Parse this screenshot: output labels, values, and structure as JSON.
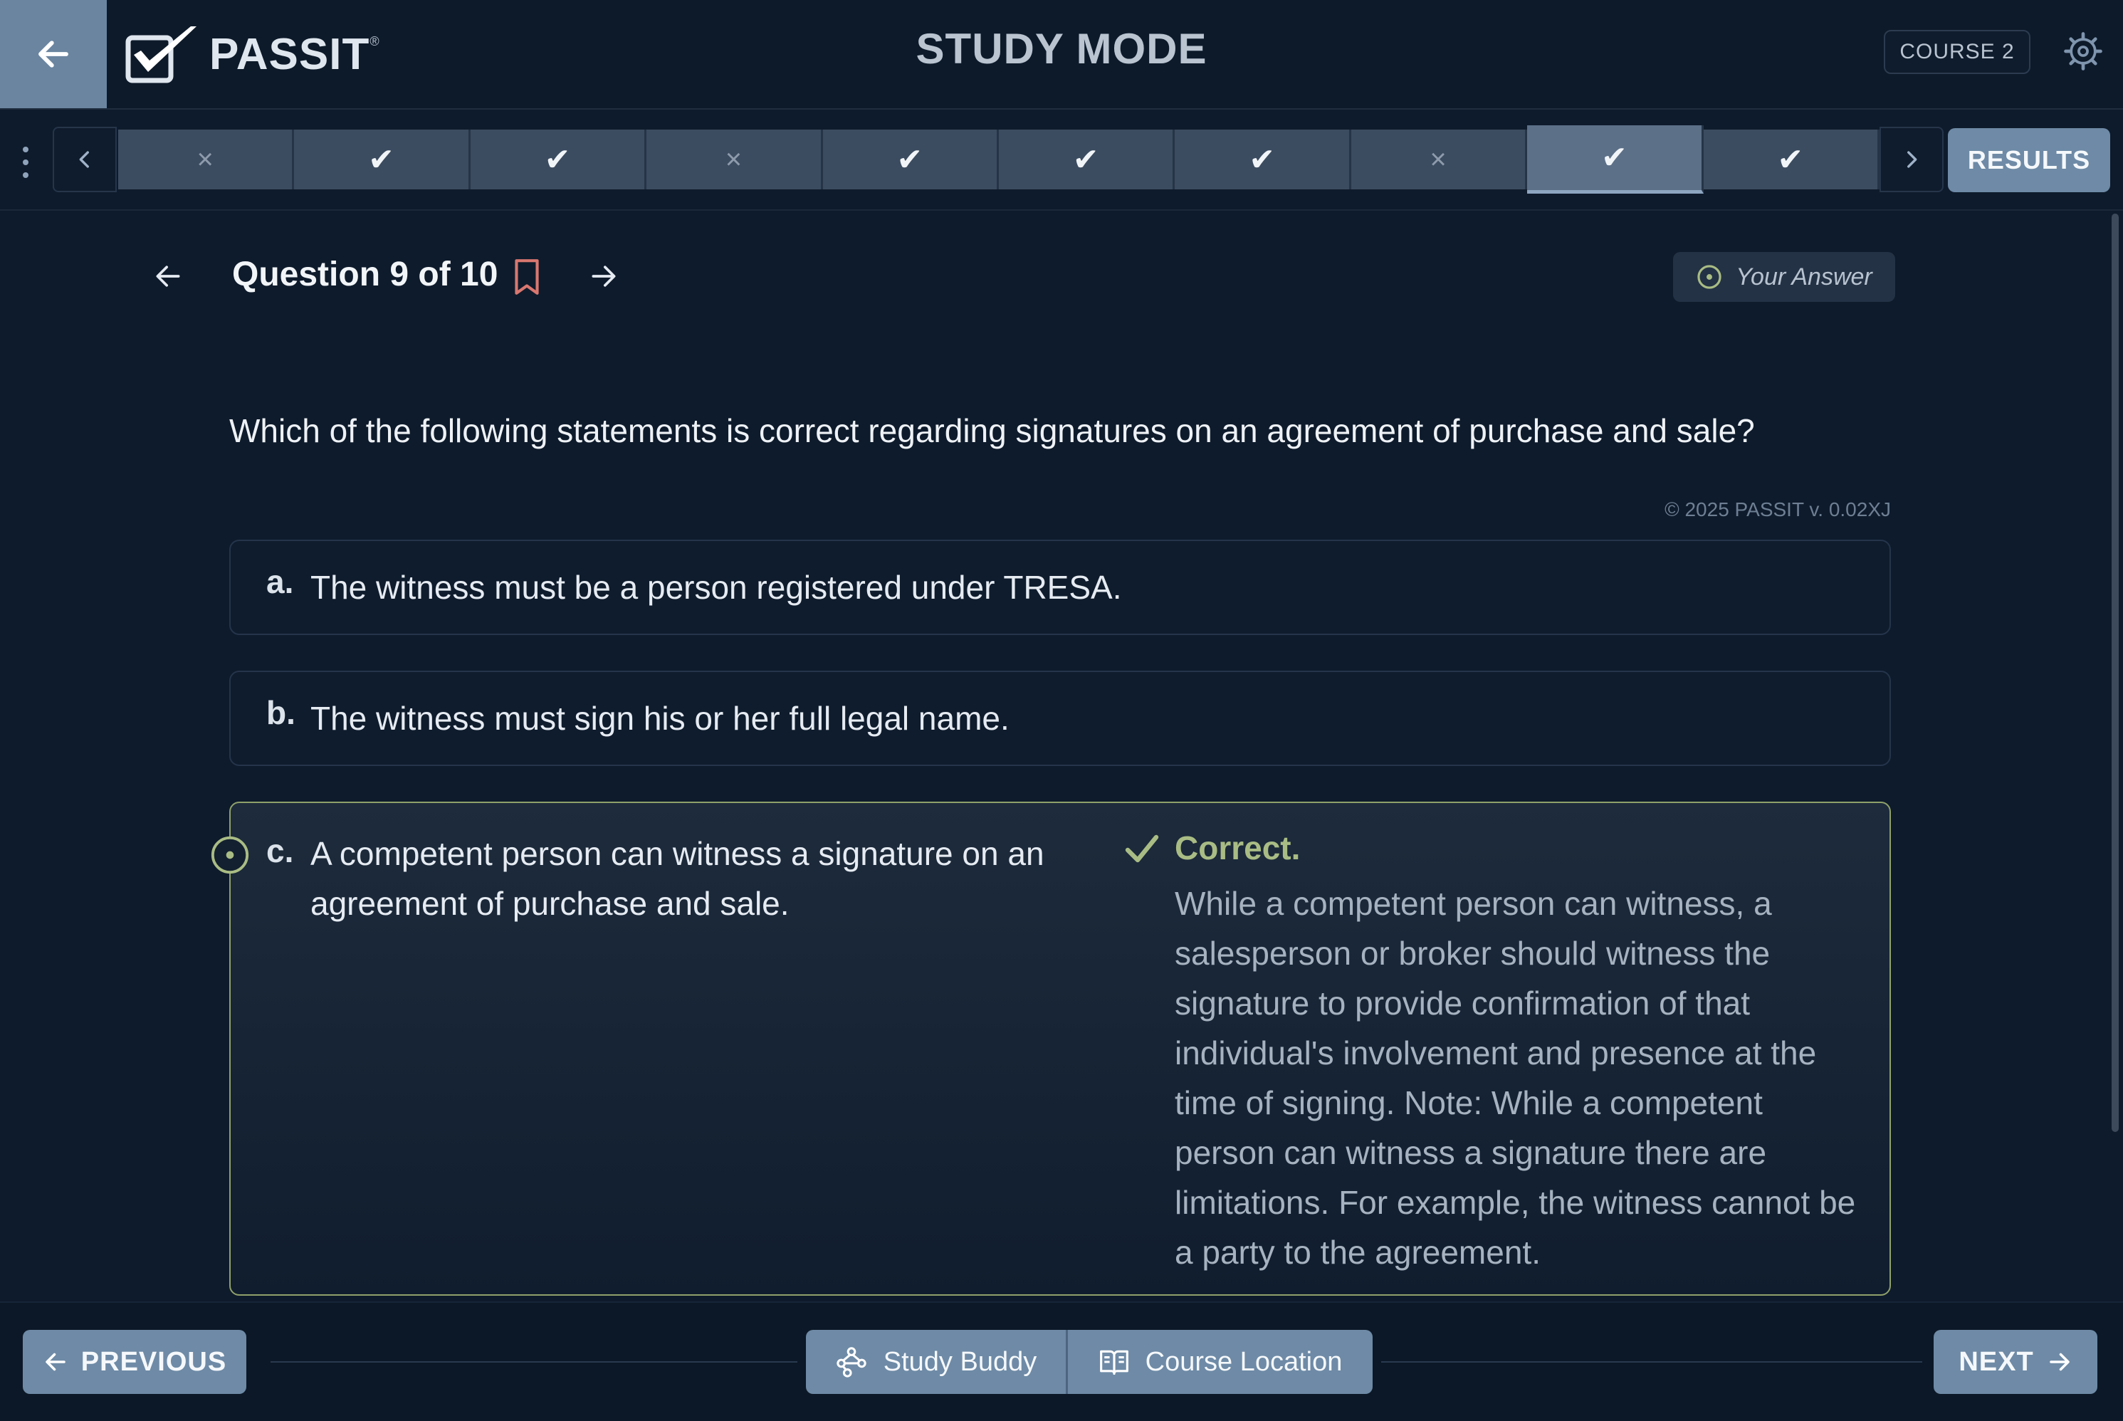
{
  "header": {
    "logo_text": "PASSIT",
    "logo_reg": "®",
    "mode_title": "STUDY MODE",
    "course_badge": "COURSE 2",
    "icons": {
      "back": "arrow-left-icon",
      "settings": "gear-icon"
    }
  },
  "progress": {
    "questions": [
      {
        "number": 1,
        "status": "incorrect",
        "glyph": "×"
      },
      {
        "number": 2,
        "status": "correct",
        "glyph": "✔"
      },
      {
        "number": 3,
        "status": "correct",
        "glyph": "✔"
      },
      {
        "number": 4,
        "status": "incorrect",
        "glyph": "×"
      },
      {
        "number": 5,
        "status": "correct",
        "glyph": "✔"
      },
      {
        "number": 6,
        "status": "correct",
        "glyph": "✔"
      },
      {
        "number": 7,
        "status": "correct",
        "glyph": "✔"
      },
      {
        "number": 8,
        "status": "incorrect",
        "glyph": "×"
      },
      {
        "number": 9,
        "status": "correct",
        "glyph": "✔",
        "current": true
      },
      {
        "number": 10,
        "status": "correct",
        "glyph": "✔"
      }
    ],
    "results_label": "RESULTS"
  },
  "question": {
    "title": "Question 9 of 10",
    "your_answer_label": "Your Answer",
    "text": "Which of the following statements is correct regarding signatures on an agreement of purchase and sale?",
    "copyright": "© 2025 PASSIT v. 0.02XJ",
    "answers": [
      {
        "letter": "a.",
        "text": "The witness must be a person registered under TRESA."
      },
      {
        "letter": "b.",
        "text": "The witness must sign his or her full legal name."
      },
      {
        "letter": "c.",
        "text": "A competent person can witness a signature on an agreement of purchase and sale.",
        "selected": true,
        "correct": true
      }
    ],
    "feedback": {
      "title": "Correct.",
      "explanation": "While a competent person can witness, a salesperson or broker should witness the signature to provide confirmation of that individual's involvement and presence at the time of signing. Note: While a competent person can witness a signature there are limitations. For example, the witness cannot be a party to the agreement."
    }
  },
  "footer": {
    "previous_label": "PREVIOUS",
    "study_buddy_label": "Study Buddy",
    "course_location_label": "Course Location",
    "next_label": "NEXT"
  },
  "colors": {
    "background": "#0e1b2c",
    "button": "#6e8aa6",
    "correct_accent": "#a9bc84",
    "bookmark": "#d9776f"
  }
}
